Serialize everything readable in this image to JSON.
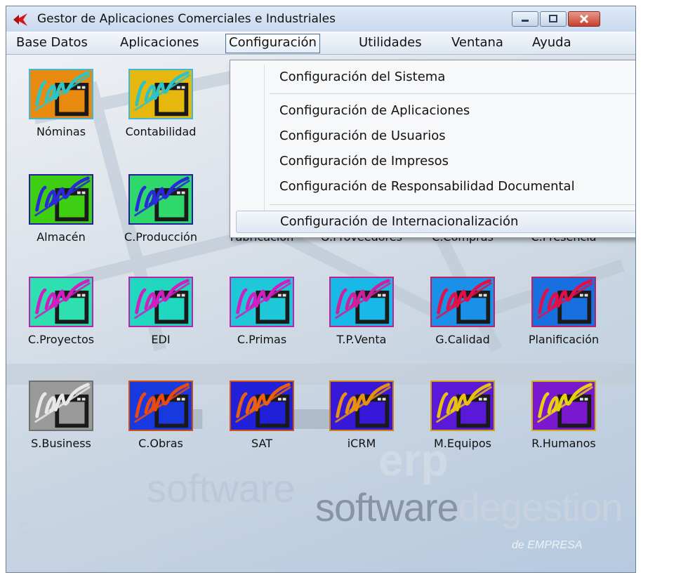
{
  "window": {
    "title": "Gestor de Aplicaciones Comerciales e Industriales"
  },
  "menubar": {
    "items": [
      "Base Datos",
      "Aplicaciones",
      "Configuración",
      "Utilidades",
      "Ventana",
      "Ayuda"
    ],
    "active": "Configuración"
  },
  "dropdown": {
    "items": [
      "Configuración del Sistema",
      "Configuración de Aplicaciones",
      "Configuración de Usuarios",
      "Configuración de Impresos",
      "Configuración de Responsabilidad Documental",
      "Configuración de Internacionalización"
    ],
    "highlighted": "Configuración de Internacionalización"
  },
  "apps": [
    {
      "label": "Nóminas",
      "bg": "#e88a10",
      "stroke": "#2ec4c4",
      "border": "#3fb8e0"
    },
    {
      "label": "Contabilidad",
      "bg": "#e6b80e",
      "stroke": "#2ec4c4",
      "border": "#3fb8e0"
    },
    {
      "label": "Almacén",
      "bg": "#3fcf12",
      "stroke": "#2a2ad8",
      "border": "#2020a0"
    },
    {
      "label": "C.Producción",
      "bg": "#2fd86a",
      "stroke": "#2a2ad8",
      "border": "#2020a0"
    },
    {
      "label": "Fabricación"
    },
    {
      "label": "O.Proveedores"
    },
    {
      "label": "C.Compras"
    },
    {
      "label": "C.Presencia"
    },
    {
      "label": "C.Proyectos",
      "bg": "#2ee0b0",
      "stroke": "#d01fc0",
      "border": "#c020b0"
    },
    {
      "label": "EDI",
      "bg": "#20d8c0",
      "stroke": "#d01fc0",
      "border": "#c020b0"
    },
    {
      "label": "C.Primas",
      "bg": "#1ec8d8",
      "stroke": "#d01fc0",
      "border": "#c020b0"
    },
    {
      "label": "T.P.Venta",
      "bg": "#18b8e8",
      "stroke": "#d01f9a",
      "border": "#c02090"
    },
    {
      "label": "G.Calidad",
      "bg": "#1a90e8",
      "stroke": "#e0104a",
      "border": "#c02060"
    },
    {
      "label": "Planificación",
      "bg": "#1870e0",
      "stroke": "#e0104a",
      "border": "#c02060"
    },
    {
      "label": "S.Business",
      "bg": "#9a9a9a",
      "stroke": "#e8e8e8",
      "border": "#707070"
    },
    {
      "label": "C.Obras",
      "bg": "#1838e0",
      "stroke": "#e84a10",
      "border": "#d05010"
    },
    {
      "label": "SAT",
      "bg": "#2020d8",
      "stroke": "#e86010",
      "border": "#d05010"
    },
    {
      "label": "iCRM",
      "bg": "#3818d8",
      "stroke": "#e89010",
      "border": "#d08010"
    },
    {
      "label": "M.Equipos",
      "bg": "#5a18d8",
      "stroke": "#e8c010",
      "border": "#d0a010"
    },
    {
      "label": "R.Humanos",
      "bg": "#7a18d0",
      "stroke": "#e8d010",
      "border": "#d0b010"
    }
  ],
  "branding": {
    "wordmark": "erp",
    "tagline_main": "software",
    "tagline_light": "degestion",
    "tagline_small": "de EMPRESA",
    "watermark_1": "software",
    "watermark_2": "ftware"
  }
}
